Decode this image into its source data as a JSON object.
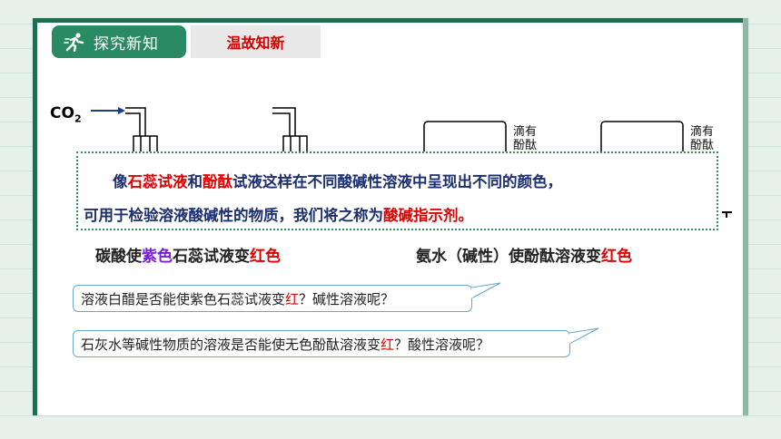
{
  "header": {
    "section_title": "探究新知",
    "subtitle": "温故知新"
  },
  "experiment": {
    "co2_label": "CO",
    "co2_sub": "2",
    "beaker_label_1a": "滴有",
    "beaker_label_1b": "酚酞",
    "beaker_label_2a": "滴有",
    "beaker_label_2b": "酚酞"
  },
  "definition": {
    "l1_p1": "像",
    "l1_p2": "石蕊试液",
    "l1_p3": "和",
    "l1_p4": "酚酞",
    "l1_p5": "试液这样在不同酸碱性溶液中呈现出不同的颜色，",
    "l2_p1": "可用于检验溶液酸碱性的物质，我们将之称为",
    "l2_p2": "酸碱指示剂。"
  },
  "captions": {
    "left_p1": "碳酸使",
    "left_p2": "紫色",
    "left_p3": "石蕊试液变",
    "left_p4": "红色",
    "right_p1": "氨水（碱性）使酚酞溶液变",
    "right_p2": "红色"
  },
  "questions": {
    "q1_p1": "溶液白醋是否能使紫色石蕊试液变",
    "q1_p2": "红",
    "q1_p3": "？碱性溶液呢？",
    "q2_p1": "石灰水等碱性物质的溶液是否能使无色酚酞溶液变",
    "q2_p2": "红",
    "q2_p3": "？酸性溶液呢？"
  },
  "colors": {
    "accent_green": "#2a8a63",
    "red": "#e00000",
    "purple": "#7a1fd6",
    "navy": "#1c2f6e"
  }
}
